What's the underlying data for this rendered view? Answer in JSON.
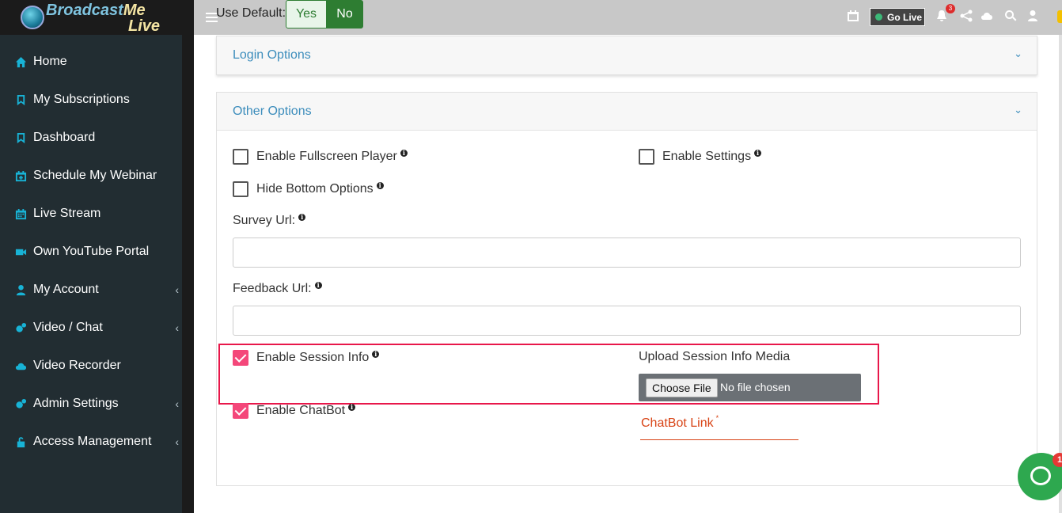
{
  "brand": {
    "name_part1": "Broadcast",
    "name_part2": "Me",
    "name_sub": "Live"
  },
  "sidebar": {
    "items": [
      {
        "label": "Home",
        "icon": "home-icon",
        "has_submenu": false
      },
      {
        "label": "My Subscriptions",
        "icon": "bookmark-icon",
        "has_submenu": false
      },
      {
        "label": "Dashboard",
        "icon": "bookmark-icon",
        "has_submenu": false
      },
      {
        "label": "Schedule My Webinar",
        "icon": "calendar-plus-icon",
        "has_submenu": false
      },
      {
        "label": "Live Stream",
        "icon": "calendar-icon",
        "has_submenu": false
      },
      {
        "label": "Own YouTube Portal",
        "icon": "video-camera-icon",
        "has_submenu": false
      },
      {
        "label": "My Account",
        "icon": "user-icon",
        "has_submenu": true
      },
      {
        "label": "Video / Chat",
        "icon": "cogs-icon",
        "has_submenu": true
      },
      {
        "label": "Video Recorder",
        "icon": "cloud-upload-icon",
        "has_submenu": false
      },
      {
        "label": "Admin Settings",
        "icon": "cogs-icon",
        "has_submenu": true
      },
      {
        "label": "Access Management",
        "icon": "unlock-icon",
        "has_submenu": true
      }
    ],
    "submenu_chevron": "‹"
  },
  "topbar": {
    "use_default_label": "Use Default:",
    "yes_label": "Yes",
    "no_label": "No",
    "go_live_label": "Go Live",
    "notification_count": "3",
    "icons": [
      "calendar-icon",
      "bell-icon",
      "share-icon",
      "cloud-upload-icon",
      "search-icon",
      "user-icon"
    ]
  },
  "panels": {
    "login": {
      "title": "Login Options",
      "caret": "⌄"
    },
    "other": {
      "title": "Other Options",
      "caret": "⌄"
    }
  },
  "options": {
    "fullscreen": {
      "label": "Enable Fullscreen Player",
      "checked": false
    },
    "settings": {
      "label": "Enable Settings",
      "checked": false
    },
    "hide_bottom": {
      "label": "Hide Bottom Options",
      "checked": false
    },
    "survey_url": {
      "label": "Survey Url:",
      "value": ""
    },
    "feedback_url": {
      "label": "Feedback Url:",
      "value": ""
    },
    "session_info": {
      "label": "Enable Session Info",
      "checked": true
    },
    "upload_media": {
      "label": "Upload Session Info Media",
      "button": "Choose File",
      "status": "No file chosen"
    },
    "chatbot": {
      "label": "Enable ChatBot",
      "checked": true
    },
    "chatbot_link": {
      "label": "ChatBot Link",
      "required_mark": "*"
    }
  },
  "info_glyph": "i",
  "chat_widget": {
    "badge": "1"
  },
  "colors": {
    "sidebar_bg": "#222d32",
    "accent_blue": "#3c8dbc",
    "icon_cyan": "#18b3d6",
    "checkbox_pink": "#f4477a",
    "highlight_red": "#e8174a",
    "go_green": "#2e7d32"
  }
}
